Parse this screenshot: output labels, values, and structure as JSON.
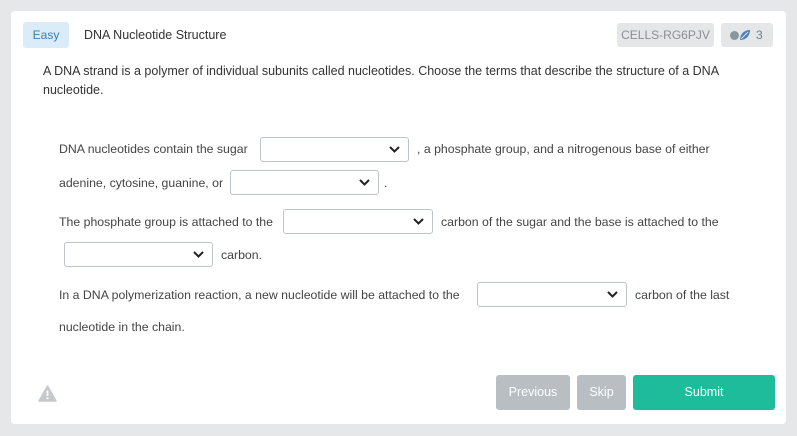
{
  "header": {
    "difficulty": "Easy",
    "title": "DNA Nucleotide Structure",
    "question_id": "CELLS-RG6PJV",
    "stat_count": "3",
    "colors": {
      "difficulty_bg": "#d9ecf8",
      "difficulty_text": "#3c7db1",
      "badge_bg": "#e4e6e8",
      "leaf": "#4c82b8"
    },
    "icons": [
      "status-dot-icon",
      "leaf-icon"
    ]
  },
  "prompt": "A DNA strand is a polymer of individual subunits called nucleotides. Choose the terms that describe the structure of a DNA nucleotide.",
  "sentences": {
    "s1_part1": "DNA nucleotides contain the sugar",
    "s1_part2": ", a phosphate group, and a nitrogenous base of either",
    "s1_part3": "adenine, cytosine, guanine, or",
    "s1_part4": ".",
    "s2_part1": "The phosphate group is attached to the",
    "s2_part2": "carbon of the sugar and the base is attached to the",
    "s2_part3": "carbon.",
    "s3_part1": "In a DNA polymerization reaction, a new nucleotide will be attached to the",
    "s3_part2": "carbon of the last",
    "s3_part3": "nucleotide in the chain."
  },
  "dropdowns": [
    {
      "id": "sugar",
      "value": ""
    },
    {
      "id": "base",
      "value": ""
    },
    {
      "id": "phosphate-carbon",
      "value": ""
    },
    {
      "id": "base-carbon",
      "value": ""
    },
    {
      "id": "polymerization-carbon",
      "value": ""
    }
  ],
  "footer": {
    "previous_label": "Previous",
    "skip_label": "Skip",
    "submit_label": "Submit",
    "colors": {
      "secondary": "#b9bec3",
      "primary": "#1fbc9c"
    },
    "icons": [
      "warning-icon"
    ]
  }
}
